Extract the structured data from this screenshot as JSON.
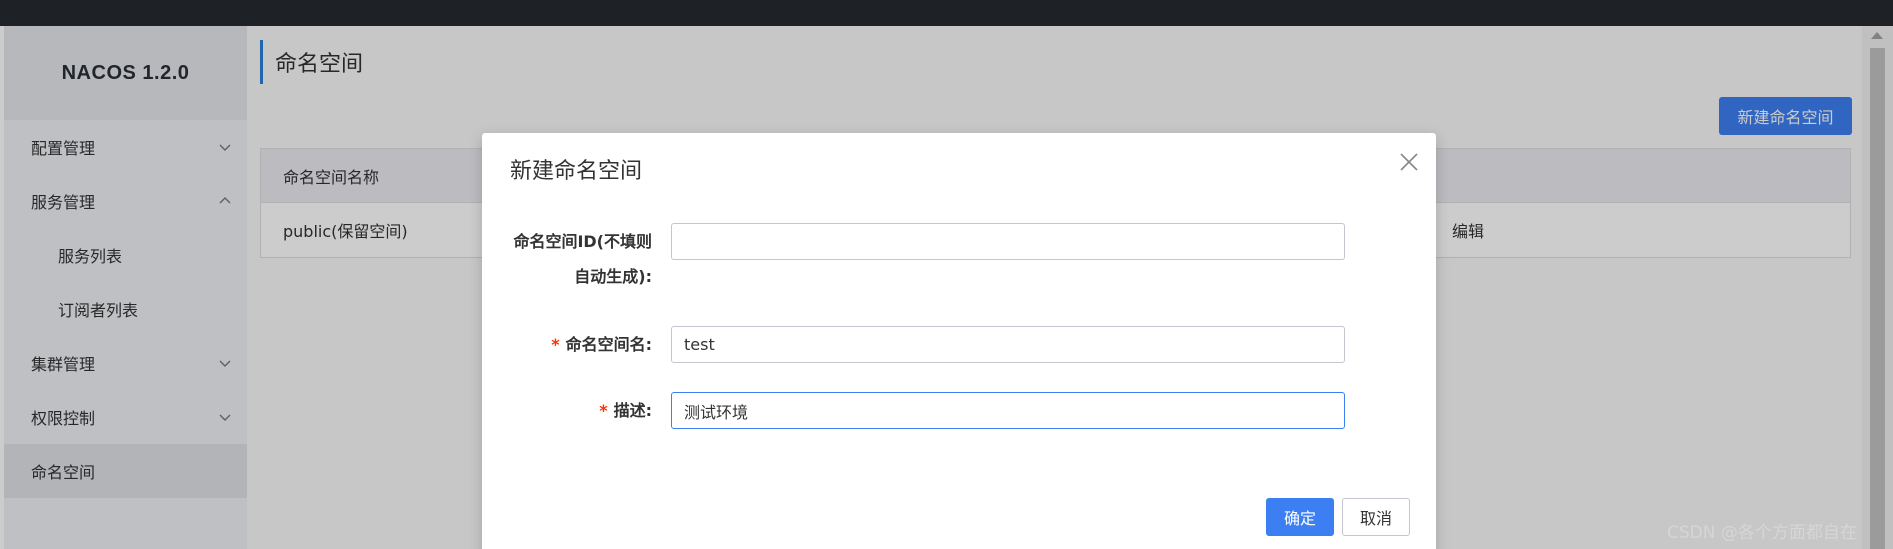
{
  "sidebar": {
    "brand": "NACOS 1.2.0",
    "items": [
      {
        "label": "配置管理",
        "chevron": "down"
      },
      {
        "label": "服务管理",
        "chevron": "up"
      },
      {
        "label": "服务列表"
      },
      {
        "label": "订阅者列表"
      },
      {
        "label": "集群管理",
        "chevron": "down"
      },
      {
        "label": "权限控制",
        "chevron": "down"
      },
      {
        "label": "命名空间"
      }
    ]
  },
  "main": {
    "title": "命名空间",
    "new_button": "新建命名空间",
    "table": {
      "header_name": "命名空间名称",
      "rows": [
        {
          "name": "public(保留空间)",
          "action": "编辑"
        }
      ]
    }
  },
  "dialog": {
    "title": "新建命名空间",
    "fields": {
      "id_label_line1": "命名空间ID(不填则",
      "id_label_line2": "自动生成):",
      "id_value": "",
      "name_label": "命名空间名:",
      "name_value": "test",
      "desc_label": "描述:",
      "desc_value": "测试环境",
      "required_mark": "*"
    },
    "ok_button": "确定",
    "cancel_button": "取消"
  },
  "watermark": "CSDN @各个方面都自在",
  "colors": {
    "accent": "#3c7ff3",
    "topbar": "#262a30",
    "required": "#ff3000",
    "title_bar": "#2a7fd8"
  },
  "icons": {
    "close": "close-icon",
    "chevron_down": "chevron-down-icon",
    "chevron_up": "chevron-up-icon"
  }
}
